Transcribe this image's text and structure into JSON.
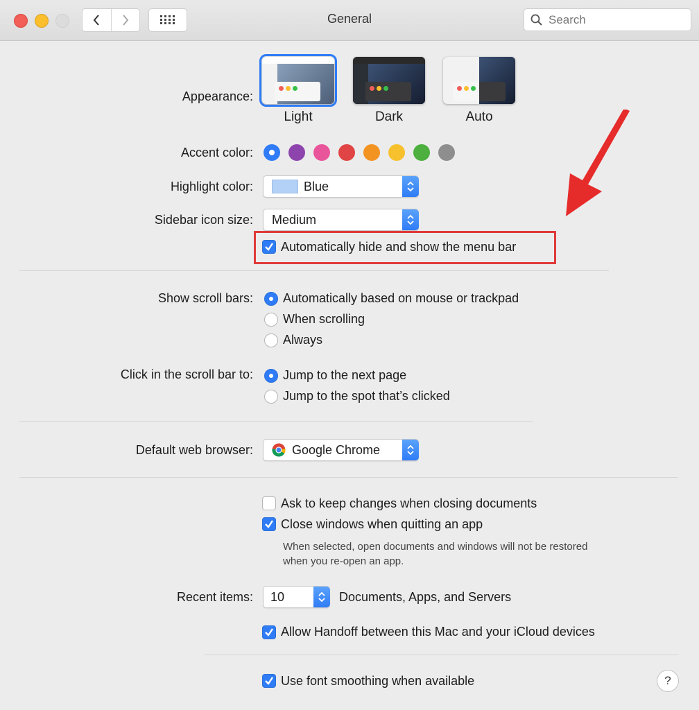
{
  "window": {
    "title": "General"
  },
  "search": {
    "placeholder": "Search"
  },
  "appearance": {
    "label": "Appearance:",
    "options": [
      {
        "name": "Light",
        "selected": true
      },
      {
        "name": "Dark",
        "selected": false
      },
      {
        "name": "Auto",
        "selected": false
      }
    ]
  },
  "accent": {
    "label": "Accent color:",
    "colors": [
      "#2f7cf6",
      "#8e44ad",
      "#e9559a",
      "#e04444",
      "#f39322",
      "#f7c12e",
      "#4caf3e",
      "#8e8e8e"
    ],
    "selected_index": 0
  },
  "highlight": {
    "label": "Highlight color:",
    "value": "Blue",
    "swatch": "#b3d1f7"
  },
  "sidebar_size": {
    "label": "Sidebar icon size:",
    "value": "Medium"
  },
  "menubar": {
    "label": "Automatically hide and show the menu bar",
    "checked": true
  },
  "scroll_bars": {
    "label": "Show scroll bars:",
    "options": [
      {
        "label": "Automatically based on mouse or trackpad",
        "selected": true
      },
      {
        "label": "When scrolling",
        "selected": false
      },
      {
        "label": "Always",
        "selected": false
      }
    ]
  },
  "click_scroll": {
    "label": "Click in the scroll bar to:",
    "options": [
      {
        "label": "Jump to the next page",
        "selected": true
      },
      {
        "label": "Jump to the spot that’s clicked",
        "selected": false
      }
    ]
  },
  "browser": {
    "label": "Default web browser:",
    "value": "Google Chrome"
  },
  "ask_keep": {
    "label": "Ask to keep changes when closing documents",
    "checked": false
  },
  "close_windows": {
    "label": "Close windows when quitting an app",
    "checked": true,
    "note_line1": "When selected, open documents and windows will not be restored",
    "note_line2": "when you re-open an app."
  },
  "recent": {
    "label": "Recent items:",
    "value": "10",
    "suffix": "Documents, Apps, and Servers"
  },
  "handoff": {
    "label": "Allow Handoff between this Mac and your iCloud devices",
    "checked": true
  },
  "font_smoothing": {
    "label": "Use font smoothing when available",
    "checked": true
  },
  "help": {
    "label": "?"
  },
  "colors": {
    "accent_blue": "#2f7cf6",
    "annotation_red": "#e03a3a"
  }
}
